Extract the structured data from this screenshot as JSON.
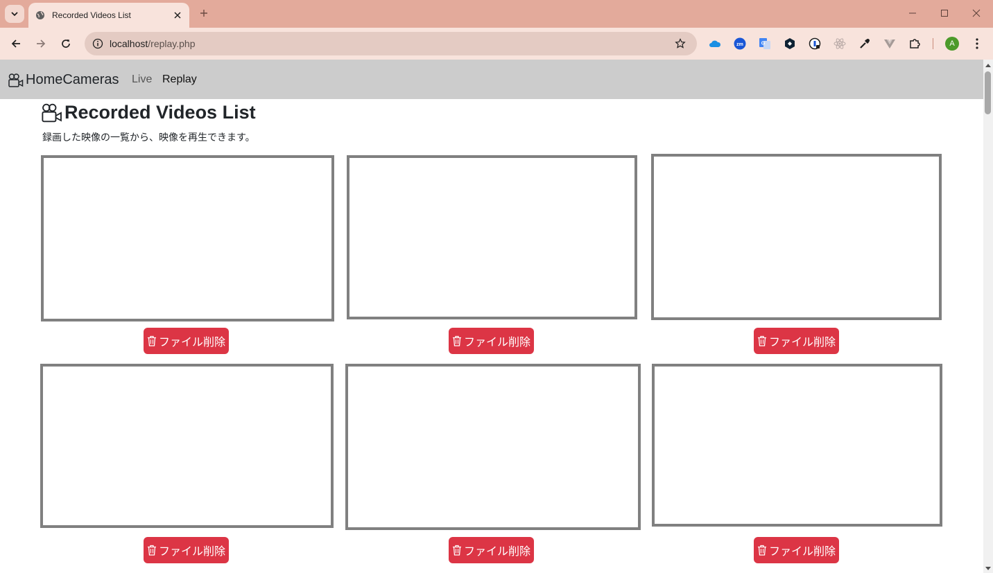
{
  "browser": {
    "tab_title": "Recorded Videos List",
    "url_host": "localhost",
    "url_path": "/replay.php",
    "profile_initial": "A",
    "extensions": [
      "cloud-icon",
      "zm-icon",
      "translate-icon",
      "hexagon-icon",
      "password-icon",
      "react-icon",
      "eyedropper-icon",
      "vue-icon",
      "puzzle-icon"
    ]
  },
  "navbar": {
    "brand": "HomeCameras",
    "links": [
      "Live",
      "Replay"
    ]
  },
  "main": {
    "title": "Recorded Videos List",
    "subtitle": "録画した映像の一覧から、映像を再生できます。",
    "delete_label": "ファイル削除",
    "videos_count_visible": 6
  },
  "colors": {
    "titlebar": "#e3aa9b",
    "toolbar": "#f8e3dc",
    "navbar": "#cccccc",
    "danger": "#dc3545",
    "video_border": "#808080"
  }
}
